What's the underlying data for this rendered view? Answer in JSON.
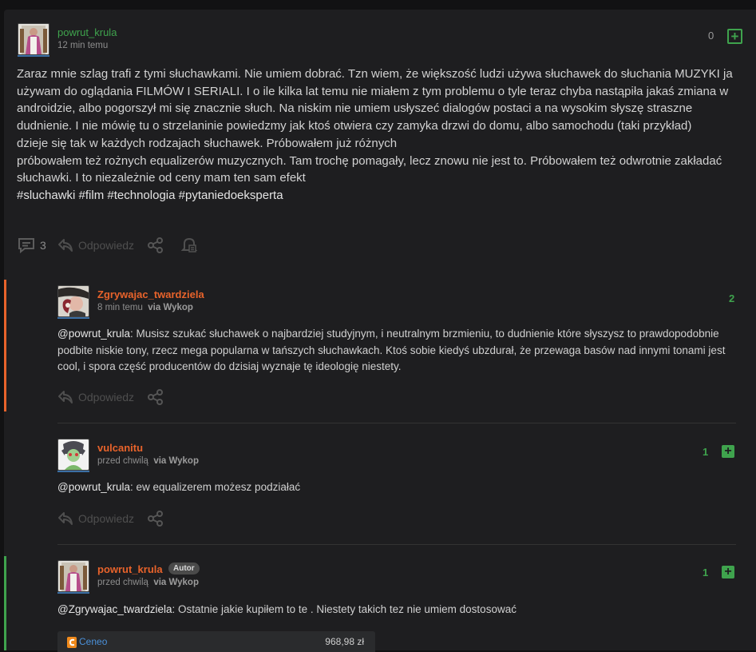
{
  "post": {
    "username": "powrut_krula",
    "time": "12 min temu",
    "votes": "0",
    "paragraphs": [
      "Zaraz mnie szlag trafi z tymi słuchawkami. Nie umiem dobrać. Tzn wiem, że większość ludzi używa słuchawek do słuchania MUZYKI ja używam do oglądania FILMÓW I SERIALI. I o ile kilka lat temu nie miałem z tym problemu o tyle teraz chyba nastąpiła jakaś zmiana w androidzie, albo pogorszył mi się znacznie słuch. Na niskim nie umiem usłyszeć dialogów postaci a na wysokim słyszę straszne dudnienie. I nie mówię tu o strzelaninie powiedzmy jak ktoś otwiera czy zamyka drzwi do domu, albo samochodu (taki przykład)",
      "dzieje się tak w każdych rodzajach słuchawek. Próbowałem już różnych",
      "próbowałem też rożnych equalizerów muzycznych. Tam trochę pomagały, lecz znowu nie jest to. Próbowałem też odwrotnie zakładać słuchawki. I to niezależnie od ceny mam ten sam efekt"
    ],
    "tags": [
      "#sluchawki",
      "#film",
      "#technologia",
      "#pytaniedoeksperta"
    ],
    "comment_count": "3",
    "reply_label": "Odpowiedz"
  },
  "comments": [
    {
      "username": "Zgrywajac_twardziela",
      "time": "8 min temu",
      "via": "via Wykop",
      "votes": "2",
      "mention": "@powrut_krula",
      "text": ": Musisz szukać słuchawek o najbardziej studyjnym, i neutralnym brzmieniu, to dudnienie które słyszysz to prawdopodobnie podbite niskie tony, rzecz mega popularna w tańszych słuchawkach. Ktoś sobie kiedyś ubzdurał, że przewaga basów nad innymi tonami jest cool, i spora część producentów do dzisiaj wyznaje tę ideologię niestety.",
      "reply_label": "Odpowiedz"
    },
    {
      "username": "vulcanitu",
      "time": "przed chwilą",
      "via": "via Wykop",
      "votes": "1",
      "mention": "@powrut_krula",
      "text": ": ew equalizerem możesz podziałać",
      "reply_label": "Odpowiedz"
    },
    {
      "username": "powrut_krula",
      "badge": "Autor",
      "time": "przed chwilą",
      "via": "via Wykop",
      "votes": "1",
      "mention": "@Zgrywajac_twardziela",
      "text": ": Ostatnie jakie kupiłem to te . Niestety takich tez nie umiem dostosować",
      "embed": {
        "brand": "Ceneo",
        "price": "968,98 zł"
      }
    }
  ],
  "colors": {
    "green": "#3fa34d",
    "orange_user": "#e8632b",
    "green_user": "#3fa34d",
    "thread_orange": "#e8632b",
    "thread_green": "#3fa34d"
  }
}
